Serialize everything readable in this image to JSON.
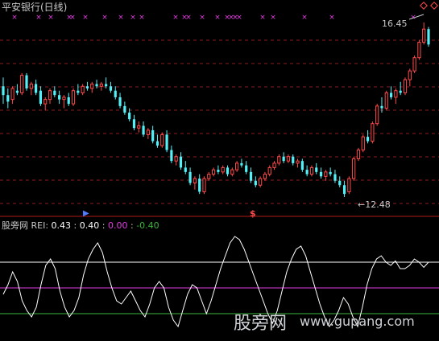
{
  "main_pane": {
    "title": "平安银行(日线)",
    "title_color": "#c8c8c8",
    "high_label": "16.45",
    "low_label": "12.48"
  },
  "indicator": {
    "source": "股旁网",
    "name": "REI:",
    "v1": "0.43",
    "sep1": ":",
    "v2": "0.40",
    "sep2": ":",
    "v3": "0.00",
    "sep3": ":",
    "v4": "-0.40"
  },
  "watermark": {
    "cn": "股旁网",
    "url": "www.gupang.com"
  },
  "colors": {
    "up": "#ff4a4a",
    "down": "#54f0f8",
    "grid": "#8c1d1d",
    "rei": "#ffffff",
    "level_high": "#ffffff",
    "level_mid": "#e03be0",
    "level_low": "#3bb63b",
    "marker": "#e03be0",
    "divider": "#b01818"
  },
  "icons": [
    "cross-marker",
    "diamond-icon",
    "dollar-signal-icon",
    "arrow-signal-icon"
  ],
  "chart_data": {
    "type": "candlestick",
    "price_range": [
      12.48,
      16.45
    ],
    "candles": [
      [
        15.0,
        15.2,
        14.6,
        14.8
      ],
      [
        14.8,
        14.95,
        14.5,
        14.65
      ],
      [
        14.7,
        15.0,
        14.6,
        14.95
      ],
      [
        14.9,
        15.05,
        14.8,
        14.85
      ],
      [
        14.85,
        15.3,
        14.8,
        15.25
      ],
      [
        15.25,
        15.3,
        14.9,
        14.95
      ],
      [
        14.95,
        15.1,
        14.8,
        15.05
      ],
      [
        15.05,
        15.15,
        14.8,
        14.85
      ],
      [
        14.9,
        15.0,
        14.55,
        14.6
      ],
      [
        14.6,
        14.75,
        14.45,
        14.7
      ],
      [
        14.7,
        14.95,
        14.6,
        14.9
      ],
      [
        14.9,
        15.0,
        14.75,
        14.8
      ],
      [
        14.8,
        14.9,
        14.6,
        14.7
      ],
      [
        14.7,
        14.8,
        14.5,
        14.75
      ],
      [
        14.75,
        14.85,
        14.55,
        14.6
      ],
      [
        14.6,
        14.95,
        14.55,
        14.9
      ],
      [
        14.9,
        15.05,
        14.8,
        14.85
      ],
      [
        14.85,
        15.05,
        14.8,
        15.0
      ],
      [
        15.0,
        15.1,
        14.9,
        14.95
      ],
      [
        14.95,
        15.1,
        14.85,
        15.05
      ],
      [
        15.05,
        15.15,
        14.95,
        15.0
      ],
      [
        15.0,
        15.1,
        14.9,
        15.05
      ],
      [
        15.05,
        15.2,
        14.95,
        15.0
      ],
      [
        15.0,
        15.1,
        14.85,
        14.9
      ],
      [
        14.9,
        15.0,
        14.7,
        14.75
      ],
      [
        14.75,
        14.85,
        14.5,
        14.55
      ],
      [
        14.55,
        14.65,
        14.35,
        14.4
      ],
      [
        14.4,
        14.5,
        14.2,
        14.25
      ],
      [
        14.25,
        14.35,
        14.0,
        14.05
      ],
      [
        14.05,
        14.2,
        13.95,
        14.1
      ],
      [
        14.1,
        14.2,
        13.85,
        13.9
      ],
      [
        13.9,
        14.05,
        13.8,
        14.0
      ],
      [
        14.0,
        14.1,
        13.7,
        13.75
      ],
      [
        13.75,
        13.9,
        13.6,
        13.65
      ],
      [
        13.65,
        13.95,
        13.6,
        13.9
      ],
      [
        13.9,
        14.0,
        13.5,
        13.55
      ],
      [
        13.55,
        13.65,
        13.25,
        13.3
      ],
      [
        13.3,
        13.45,
        13.2,
        13.4
      ],
      [
        13.4,
        13.5,
        13.1,
        13.15
      ],
      [
        13.15,
        13.3,
        13.0,
        13.05
      ],
      [
        13.05,
        13.15,
        12.75,
        12.8
      ],
      [
        12.8,
        12.95,
        12.65,
        12.9
      ],
      [
        12.9,
        13.0,
        12.55,
        12.6
      ],
      [
        12.6,
        12.95,
        12.55,
        12.9
      ],
      [
        12.9,
        13.05,
        12.85,
        13.0
      ],
      [
        13.0,
        13.15,
        12.95,
        13.1
      ],
      [
        13.1,
        13.2,
        13.0,
        13.05
      ],
      [
        13.05,
        13.2,
        13.0,
        13.15
      ],
      [
        13.15,
        13.2,
        12.95,
        13.0
      ],
      [
        13.0,
        13.15,
        12.95,
        13.1
      ],
      [
        13.1,
        13.3,
        13.05,
        13.25
      ],
      [
        13.25,
        13.35,
        13.15,
        13.2
      ],
      [
        13.2,
        13.3,
        13.0,
        13.05
      ],
      [
        13.05,
        13.15,
        12.8,
        12.85
      ],
      [
        12.85,
        12.95,
        12.7,
        12.75
      ],
      [
        12.75,
        12.95,
        12.7,
        12.9
      ],
      [
        12.9,
        13.05,
        12.85,
        13.0
      ],
      [
        13.0,
        13.2,
        12.95,
        13.15
      ],
      [
        13.15,
        13.3,
        13.1,
        13.25
      ],
      [
        13.25,
        13.45,
        13.2,
        13.4
      ],
      [
        13.4,
        13.5,
        13.25,
        13.3
      ],
      [
        13.3,
        13.45,
        13.25,
        13.4
      ],
      [
        13.4,
        13.45,
        13.2,
        13.25
      ],
      [
        13.25,
        13.35,
        13.15,
        13.3
      ],
      [
        13.3,
        13.35,
        13.05,
        13.1
      ],
      [
        13.1,
        13.2,
        12.95,
        13.0
      ],
      [
        13.0,
        13.2,
        12.95,
        13.15
      ],
      [
        13.15,
        13.25,
        13.0,
        13.05
      ],
      [
        13.05,
        13.15,
        12.9,
        12.95
      ],
      [
        12.95,
        13.1,
        12.85,
        13.05
      ],
      [
        13.05,
        13.15,
        12.95,
        13.0
      ],
      [
        13.0,
        13.1,
        12.8,
        12.85
      ],
      [
        12.85,
        12.95,
        12.7,
        12.75
      ],
      [
        12.75,
        12.85,
        12.48,
        12.55
      ],
      [
        12.6,
        12.95,
        12.55,
        12.9
      ],
      [
        12.9,
        13.4,
        12.85,
        13.35
      ],
      [
        13.35,
        13.6,
        13.3,
        13.55
      ],
      [
        13.55,
        13.9,
        13.5,
        13.85
      ],
      [
        13.85,
        14.0,
        13.7,
        13.75
      ],
      [
        13.75,
        14.2,
        13.7,
        14.15
      ],
      [
        14.15,
        14.6,
        14.1,
        14.55
      ],
      [
        14.55,
        14.75,
        14.4,
        14.5
      ],
      [
        14.5,
        14.9,
        14.45,
        14.85
      ],
      [
        14.85,
        15.0,
        14.7,
        14.75
      ],
      [
        14.75,
        14.95,
        14.6,
        14.9
      ],
      [
        14.9,
        15.1,
        14.8,
        14.85
      ],
      [
        14.85,
        15.2,
        14.8,
        15.15
      ],
      [
        15.15,
        15.4,
        15.0,
        15.35
      ],
      [
        15.35,
        15.7,
        15.3,
        15.65
      ],
      [
        15.65,
        16.05,
        15.6,
        16.0
      ],
      [
        16.0,
        16.45,
        15.95,
        16.3
      ],
      [
        16.3,
        16.35,
        15.9,
        15.95
      ]
    ],
    "rei": {
      "levels": [
        0.4,
        0.0,
        -0.4
      ],
      "values": [
        -0.1,
        0.05,
        0.25,
        0.1,
        -0.2,
        -0.35,
        -0.45,
        -0.3,
        0.05,
        0.35,
        0.45,
        0.3,
        -0.05,
        -0.3,
        -0.45,
        -0.35,
        -0.15,
        0.2,
        0.45,
        0.6,
        0.7,
        0.55,
        0.25,
        0.0,
        -0.2,
        -0.25,
        -0.15,
        -0.05,
        -0.2,
        -0.35,
        -0.45,
        -0.25,
        0.0,
        0.1,
        0.0,
        -0.3,
        -0.5,
        -0.6,
        -0.35,
        -0.1,
        0.05,
        0.0,
        -0.2,
        -0.4,
        -0.2,
        0.05,
        0.3,
        0.5,
        0.7,
        0.8,
        0.75,
        0.6,
        0.4,
        0.2,
        0.0,
        -0.2,
        -0.4,
        -0.55,
        -0.35,
        -0.05,
        0.25,
        0.45,
        0.6,
        0.65,
        0.5,
        0.25,
        0.0,
        -0.25,
        -0.45,
        -0.6,
        -0.5,
        -0.35,
        -0.15,
        -0.25,
        -0.45,
        -0.6,
        -0.3,
        0.05,
        0.3,
        0.45,
        0.5,
        0.4,
        0.35,
        0.42,
        0.3,
        0.3,
        0.35,
        0.45,
        0.4,
        0.32,
        0.4
      ]
    }
  }
}
